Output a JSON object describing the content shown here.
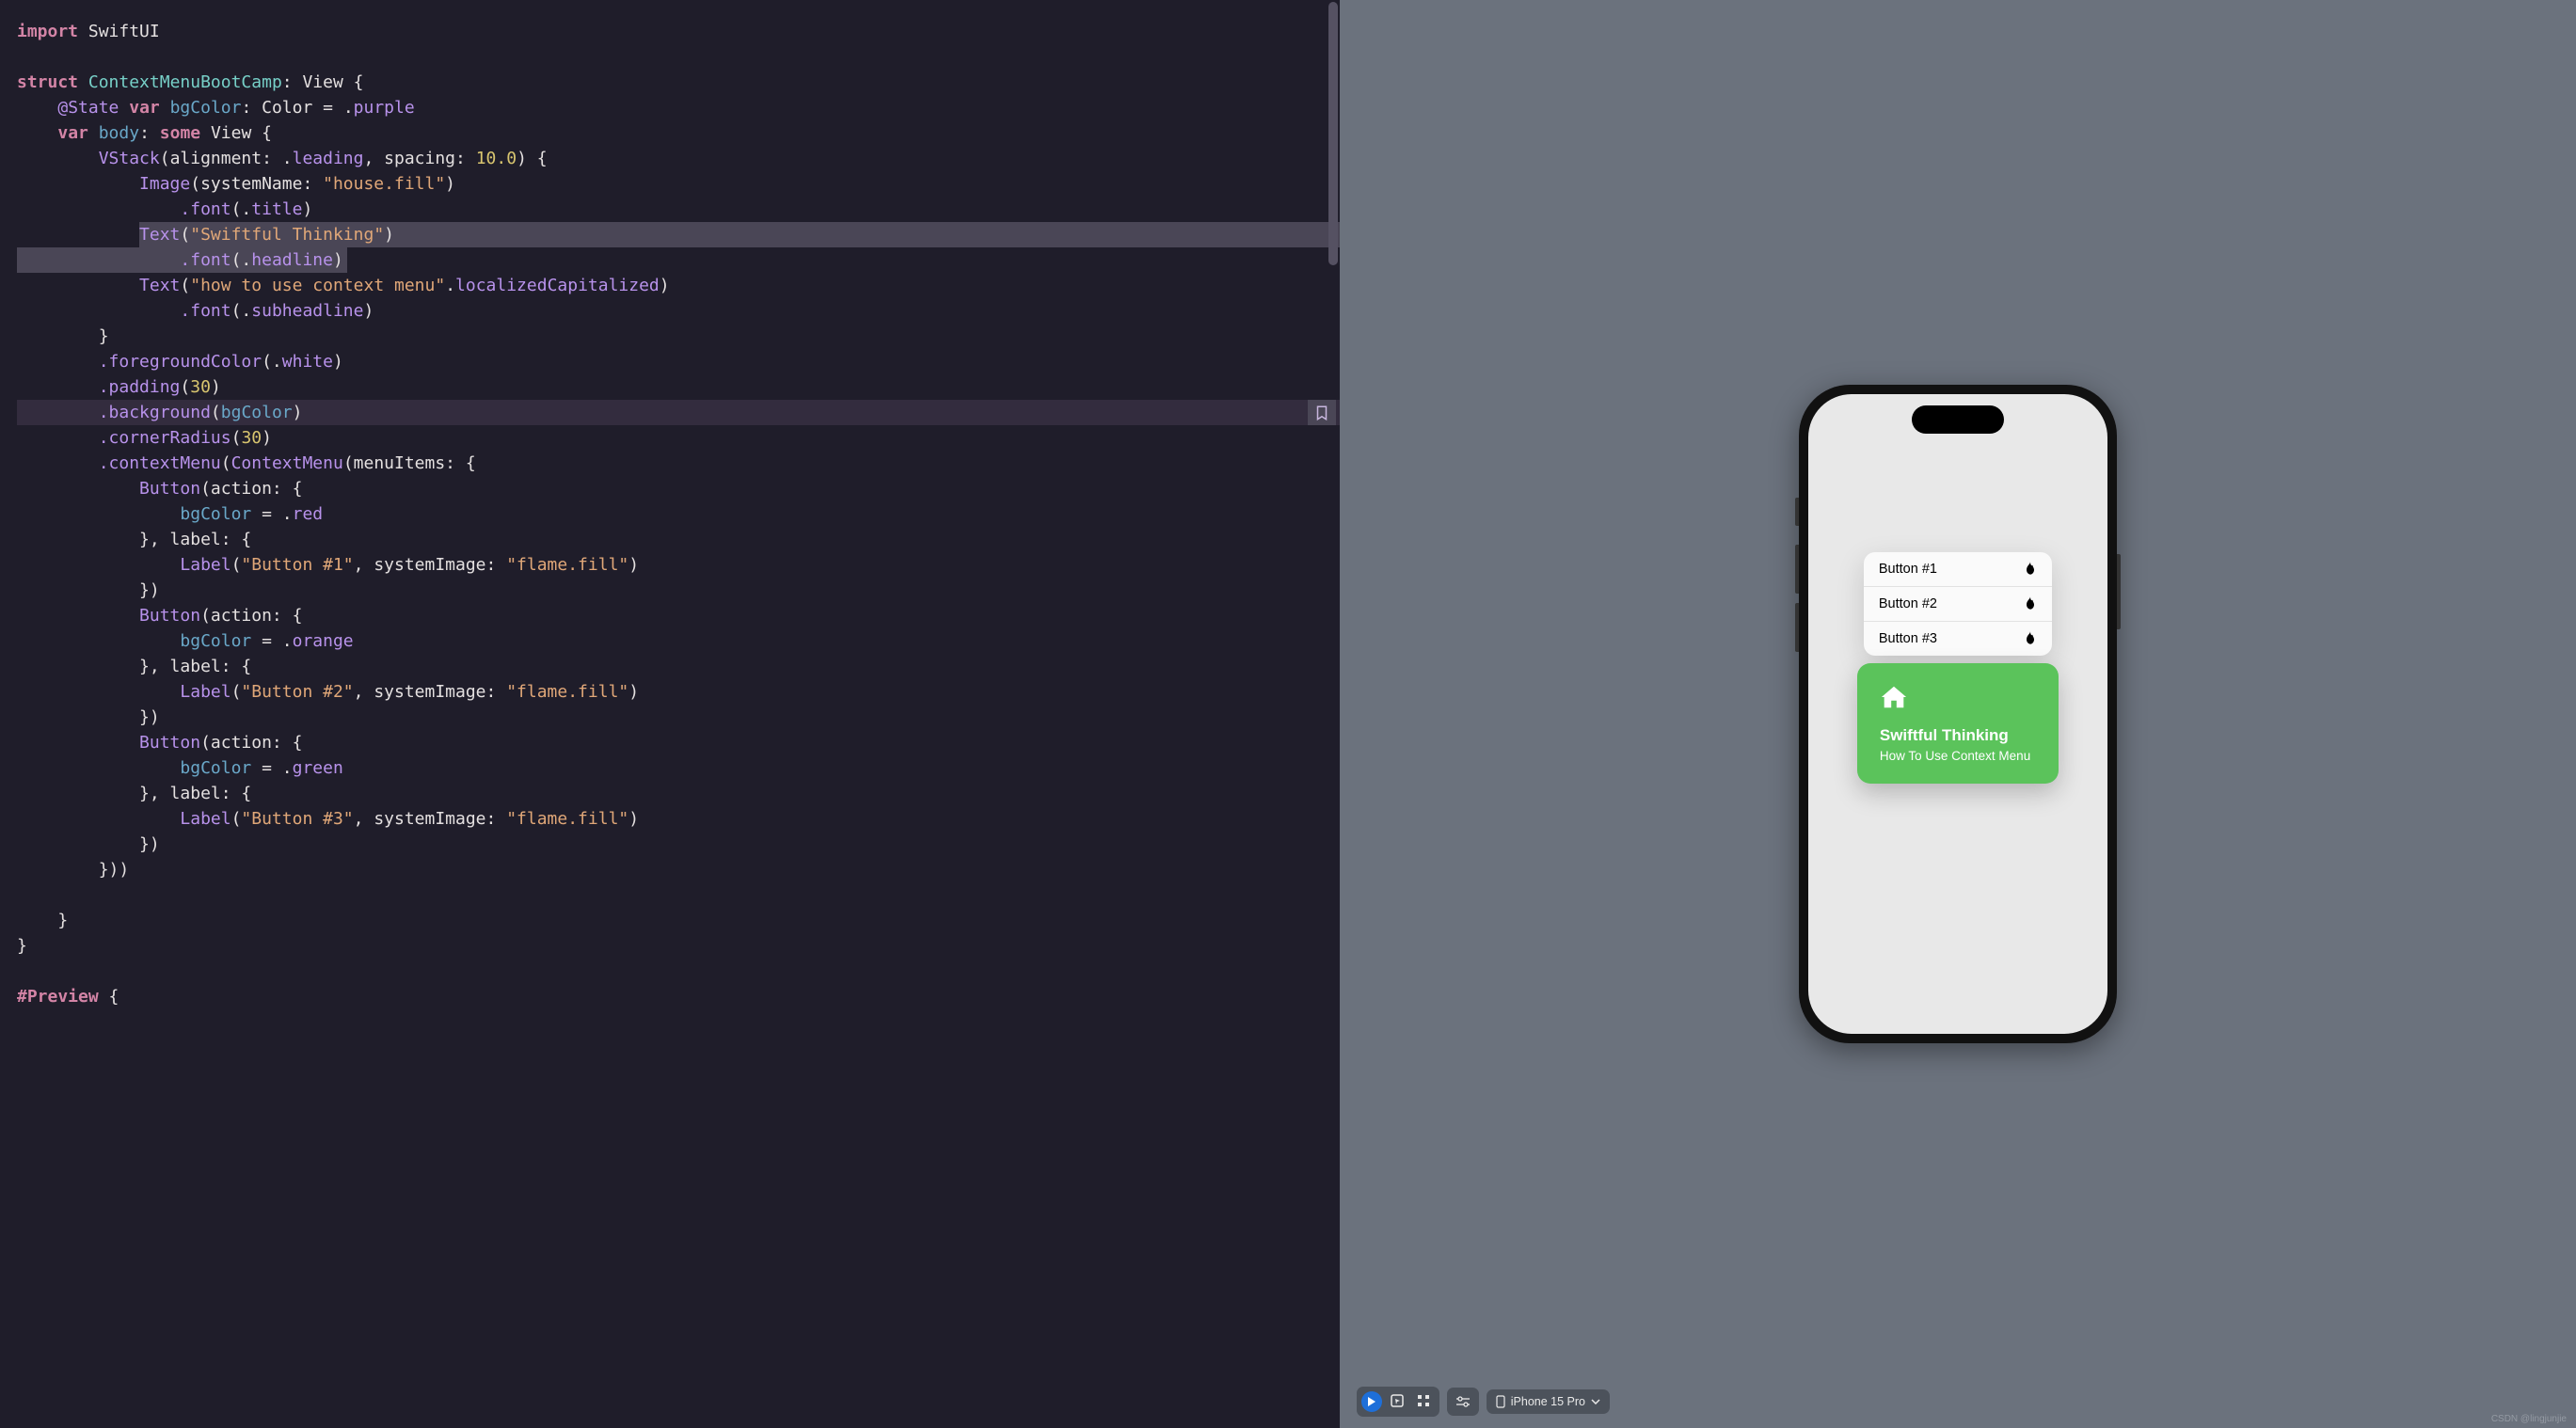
{
  "code": {
    "l1_import": "import",
    "l1_module": "SwiftUI",
    "l3_struct": "struct",
    "l3_name": "ContextMenuBootCamp",
    "l3_colon_view": ": View {",
    "l4_state": "@State",
    "l4_var": "var",
    "l4_bg": "bgColor",
    "l4_rest": ": Color = .",
    "l4_purple": "purple",
    "l5_var": "var",
    "l5_body": "body",
    "l5_some": "some",
    "l5_view": "View {",
    "l6_vstack": "VStack",
    "l6_p1": "(alignment: .",
    "l6_leading": "leading",
    "l6_p2": ", spacing: ",
    "l6_num": "10.0",
    "l6_p3": ") {",
    "l7_image": "Image",
    "l7_p1": "(systemName: ",
    "l7_str": "\"house.fill\"",
    "l7_p2": ")",
    "l8_font": ".font",
    "l8_p1": "(.",
    "l8_title": "title",
    "l8_p2": ")",
    "l9_text": "Text",
    "l9_p1": "(",
    "l9_str": "\"Swiftful Thinking\"",
    "l9_p2": ")",
    "l10_font": ".font",
    "l10_p1": "(.",
    "l10_headline": "headline",
    "l10_p2": ")",
    "l11_text": "Text",
    "l11_p1": "(",
    "l11_str": "\"how to use context menu\"",
    "l11_p2": ".",
    "l11_cap": "localizedCapitalized",
    "l11_p3": ")",
    "l12_font": ".font",
    "l12_p1": "(.",
    "l12_sub": "subheadline",
    "l12_p2": ")",
    "l13_close": "}",
    "l14_fg": ".foregroundColor",
    "l14_p1": "(.",
    "l14_white": "white",
    "l14_p2": ")",
    "l15_pad": ".padding",
    "l15_p1": "(",
    "l15_num": "30",
    "l15_p2": ")",
    "l16_bg": ".background",
    "l16_p1": "(",
    "l16_var": "bgColor",
    "l16_p2": ")",
    "l17_cr": ".cornerRadius",
    "l17_p1": "(",
    "l17_num": "30",
    "l17_p2": ")",
    "l18_cm": ".contextMenu",
    "l18_p1": "(",
    "l18_cms": "ContextMenu",
    "l18_p2": "(menuItems: {",
    "l19_btn": "Button",
    "l19_p1": "(action: {",
    "l20_bg": "bgColor",
    "l20_p1": " = .",
    "l20_red": "red",
    "l21_close": "}, label: {",
    "l22_label": "Label",
    "l22_p1": "(",
    "l22_s1": "\"Button #1\"",
    "l22_p2": ", systemImage: ",
    "l22_s2": "\"flame.fill\"",
    "l22_p3": ")",
    "l23_close": "})",
    "l24_btn": "Button",
    "l24_p1": "(action: {",
    "l25_bg": "bgColor",
    "l25_p1": " = .",
    "l25_orange": "orange",
    "l26_close": "}, label: {",
    "l27_label": "Label",
    "l27_p1": "(",
    "l27_s1": "\"Button #2\"",
    "l27_p2": ", systemImage: ",
    "l27_s2": "\"flame.fill\"",
    "l27_p3": ")",
    "l28_close": "})",
    "l29_btn": "Button",
    "l29_p1": "(action: {",
    "l30_bg": "bgColor",
    "l30_p1": " = .",
    "l30_green": "green",
    "l31_close": "}, label: {",
    "l32_label": "Label",
    "l32_p1": "(",
    "l32_s1": "\"Button #3\"",
    "l32_p2": ", systemImage: ",
    "l32_s2": "\"flame.fill\"",
    "l32_p3": ")",
    "l33_close": "})",
    "l34_close": "}))",
    "l36_close": "}",
    "l37_close": "}",
    "l39_preview": "#Preview",
    "l39_brace": " {"
  },
  "preview": {
    "menu": {
      "b1": "Button #1",
      "b2": "Button #2",
      "b3": "Button #3"
    },
    "card": {
      "title": "Swiftful Thinking",
      "sub": "How To Use Context Menu"
    }
  },
  "toolbar": {
    "device": "iPhone 15 Pro"
  },
  "watermark": "CSDN @lingjunjie"
}
